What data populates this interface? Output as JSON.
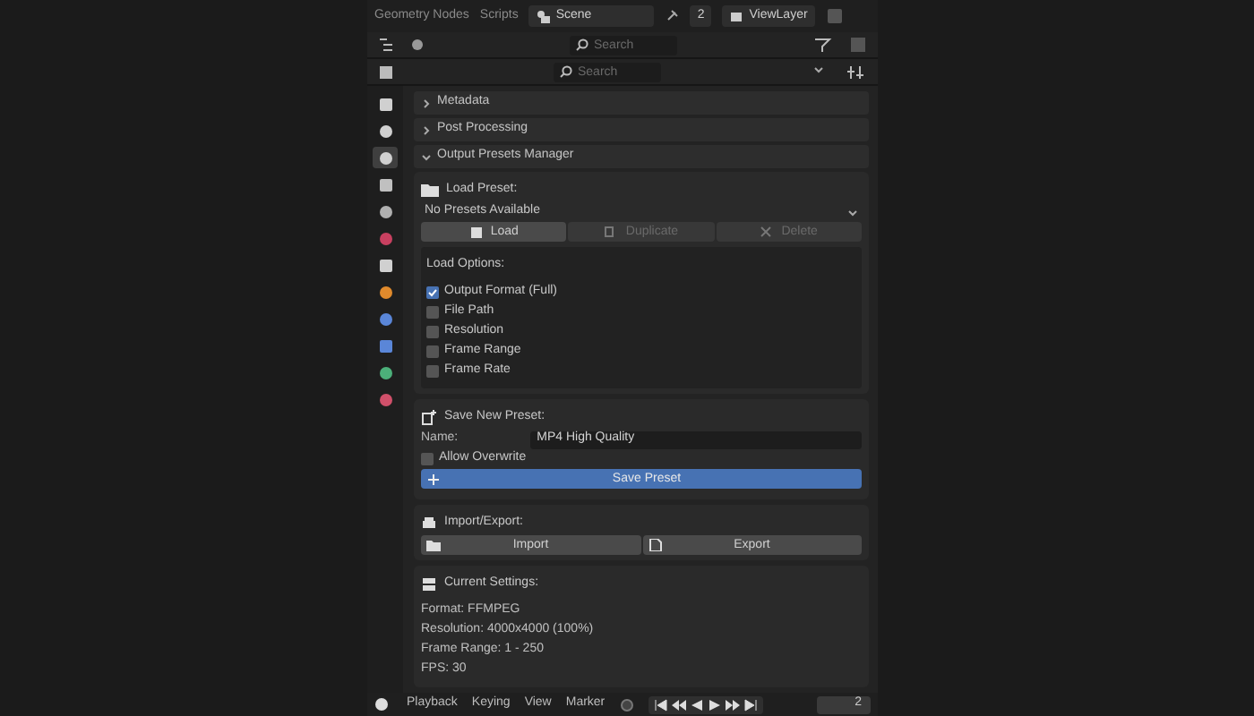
{
  "top_bar": {
    "workspace_tabs": [
      "Geometry Nodes",
      "Scripts"
    ],
    "scene": "Scene",
    "user_count": "2",
    "view_layer": "ViewLayer"
  },
  "outliner_header": {
    "search": {
      "placeholder": "Search"
    }
  },
  "properties_header": {
    "search": {
      "placeholder": "Search"
    }
  },
  "properties_tabs": [
    {
      "selected": false
    },
    {
      "selected": false
    },
    {
      "selected": true
    },
    {
      "selected": false
    },
    {
      "selected": false
    },
    {
      "selected": false
    },
    {
      "selected": false
    },
    {
      "selected": false
    },
    {
      "selected": false
    },
    {
      "selected": false
    },
    {
      "selected": false
    },
    {
      "selected": false
    }
  ],
  "panels": [
    {
      "title": "Metadata",
      "expanded": false
    },
    {
      "title": "Post Processing",
      "expanded": false
    },
    {
      "title": "Output Presets Manager",
      "expanded": true
    }
  ],
  "load_preset": {
    "title": "Load Preset:",
    "dropdown": "No Presets Available",
    "buttons": [
      {
        "label": "Load",
        "disabled": false
      },
      {
        "label": "Duplicate",
        "disabled": true
      },
      {
        "label": "Delete",
        "disabled": true
      }
    ],
    "options_title": "Load Options:",
    "options": [
      {
        "label": "Output Format (Full)",
        "checked": true
      },
      {
        "label": "File Path",
        "checked": false
      },
      {
        "label": "Resolution",
        "checked": false
      },
      {
        "label": "Frame Range",
        "checked": false
      },
      {
        "label": "Frame Rate",
        "checked": false
      }
    ]
  },
  "save_preset": {
    "title": "Save New Preset:",
    "name_label": "Name:",
    "name_value": "MP4 High Quality",
    "allow_overwrite": {
      "label": "Allow Overwrite",
      "checked": false
    },
    "button": "Save Preset"
  },
  "import_export": {
    "title": "Import/Export:",
    "buttons": [
      "Import",
      "Export"
    ]
  },
  "current_settings": {
    "title": "Current Settings:",
    "lines": [
      "Format: FFMPEG",
      "Resolution: 4000x4000 (100%)",
      "Frame Range: 1 - 250",
      "FPS: 30"
    ]
  },
  "timeline_bar": {
    "menus": [
      "Playback",
      "Keying",
      "View",
      "Marker"
    ],
    "frame": "2"
  }
}
